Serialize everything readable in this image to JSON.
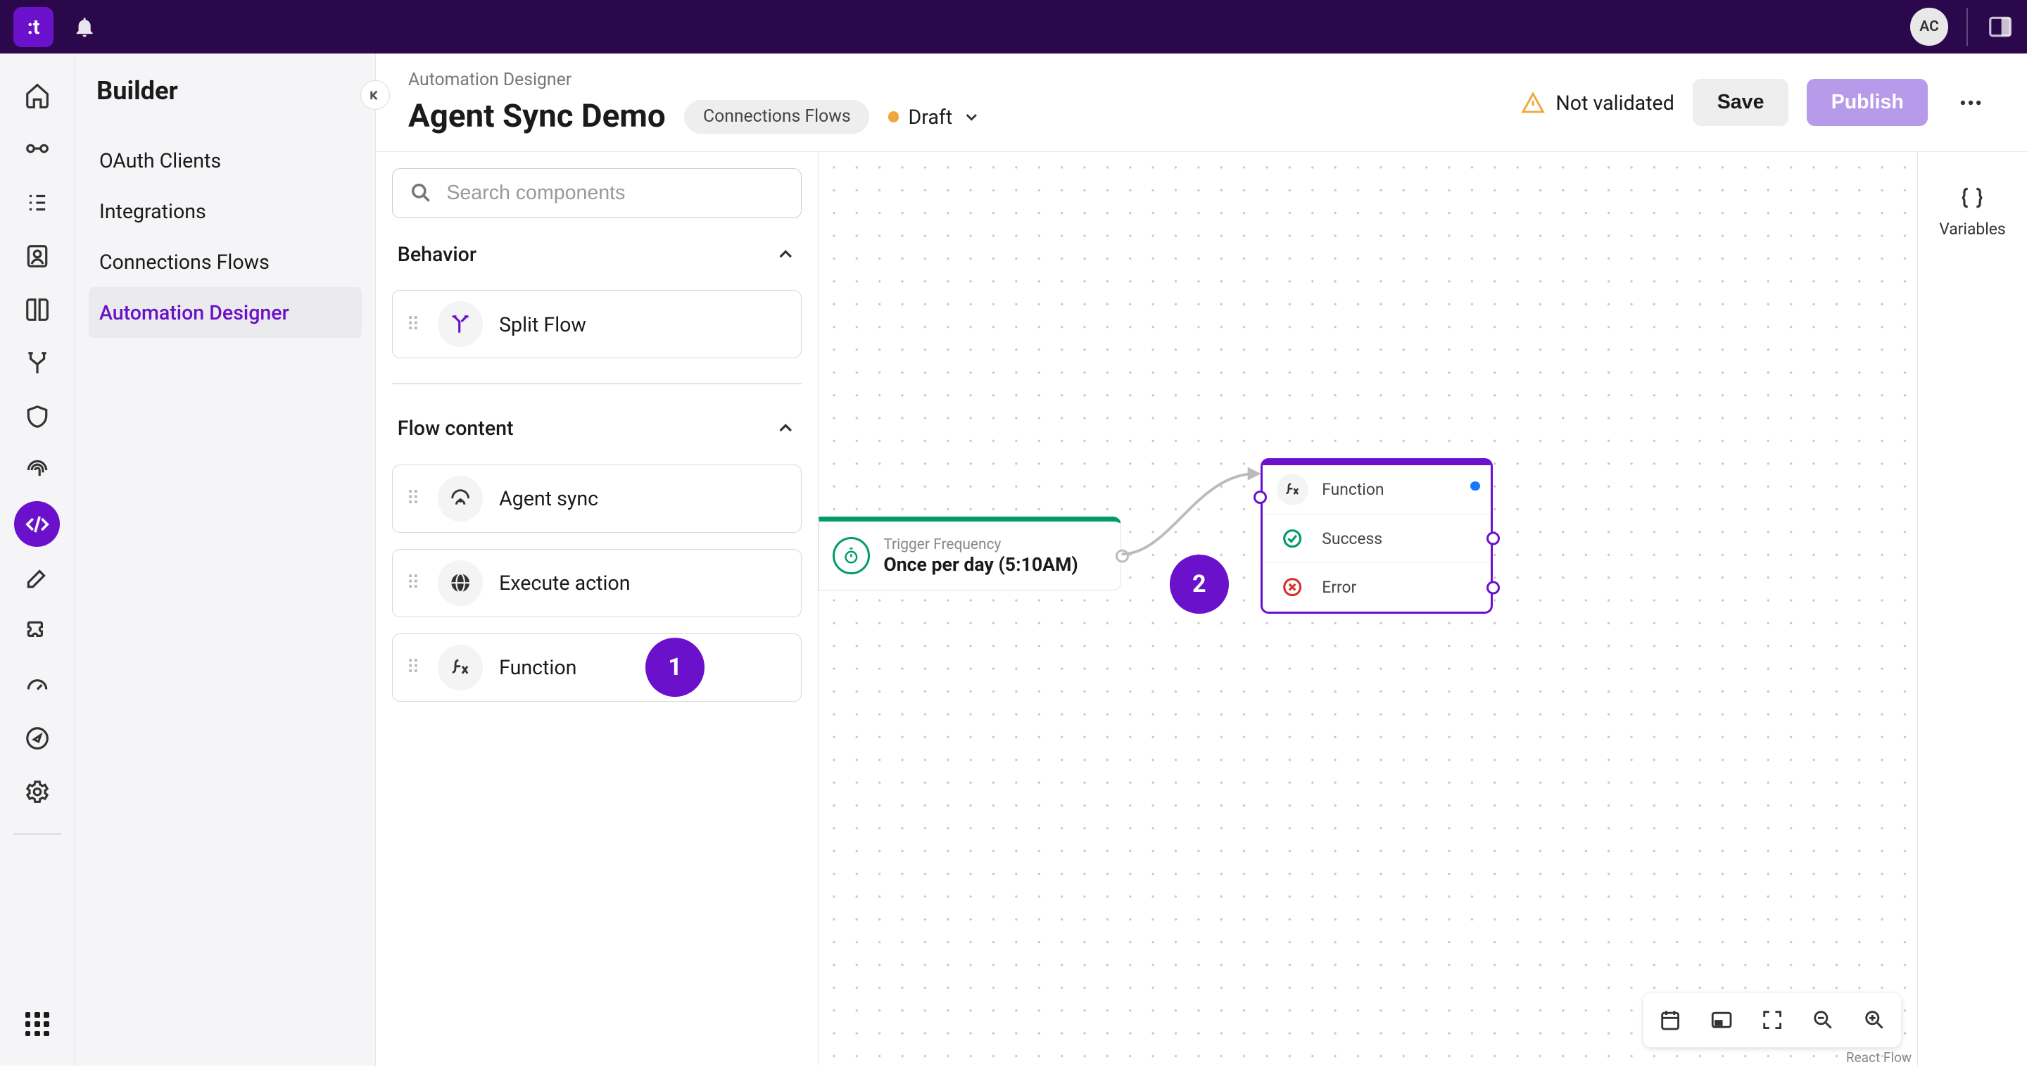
{
  "topbar": {
    "logo_initials": ":t",
    "avatar_initials": "AC"
  },
  "sidenav": {
    "title": "Builder",
    "items": [
      {
        "label": "OAuth Clients"
      },
      {
        "label": "Integrations"
      },
      {
        "label": "Connections Flows"
      },
      {
        "label": "Automation Designer"
      }
    ]
  },
  "header": {
    "breadcrumb": "Automation Designer",
    "title": "Agent Sync Demo",
    "pill": "Connections Flows",
    "status": "Draft",
    "validation": "Not validated",
    "save_label": "Save",
    "publish_label": "Publish"
  },
  "components": {
    "search_placeholder": "Search components",
    "sections": {
      "behavior": {
        "title": "Behavior",
        "items": [
          {
            "label": "Split Flow",
            "icon": "split"
          }
        ]
      },
      "flow_content": {
        "title": "Flow content",
        "items": [
          {
            "label": "Agent sync",
            "icon": "agent"
          },
          {
            "label": "Execute action",
            "icon": "globe"
          },
          {
            "label": "Function",
            "icon": "fx"
          }
        ]
      }
    }
  },
  "canvas": {
    "trigger": {
      "title": "Trigger Frequency",
      "value": "Once per day (5:10AM)"
    },
    "function_node": {
      "title": "Function",
      "success": "Success",
      "error": "Error"
    },
    "attribution": "React Flow"
  },
  "right_rail": {
    "label": "Variables"
  },
  "annotations": {
    "badge1": "1",
    "badge2": "2"
  }
}
